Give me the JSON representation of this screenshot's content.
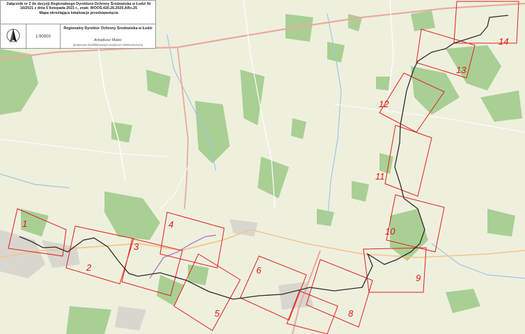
{
  "legend": {
    "header_lines": [
      "Załącznik nr 2 do decyzji Regionalnego Dyrektora Ochrony Środowiska w Łodzi Nr",
      "16/2021 z dnia 5 listopada 2021 r., znak: WOOŚ.420.26.2020.ARo.25",
      "Mapa określająca lokalizacje przedsięwzięcia"
    ],
    "scale": "1:90000",
    "signatory_title": "Regionalny Dyrektor Ochrony Środowiska w Łodzi",
    "signatory_name": "Arkadiusz Malec",
    "signature_note": "(podpisano kwalifikowanym podpisem elektronicznym)"
  },
  "sheets": [
    "1",
    "2",
    "3",
    "4",
    "5",
    "6",
    "8",
    "9",
    "10",
    "11",
    "12",
    "13",
    "14"
  ],
  "colors": {
    "route": "#2b2b2b",
    "sheet_frame": "#e02020",
    "forest": "#a9cf94",
    "background": "#eef0dd"
  },
  "icons": {
    "north_arrow": "compass-arrow-icon"
  }
}
